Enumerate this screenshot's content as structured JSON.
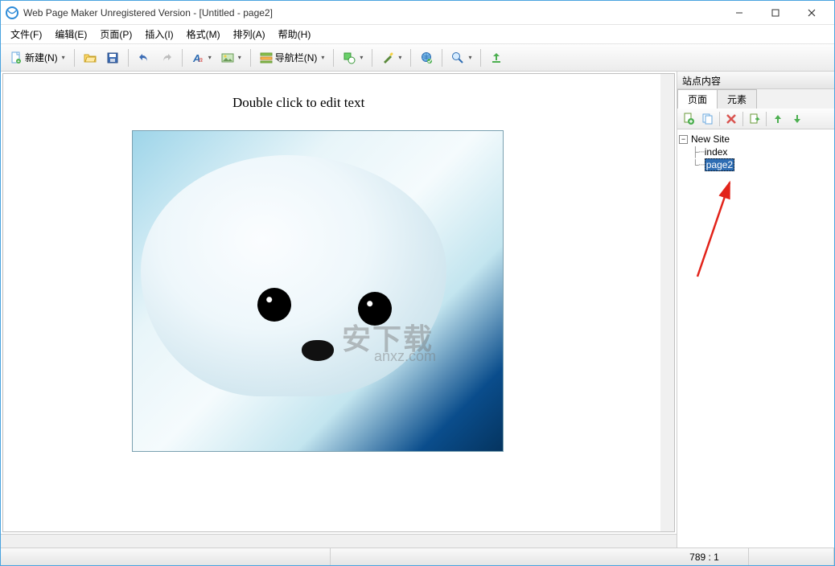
{
  "title": "Web Page Maker Unregistered Version - [Untitled - page2]",
  "menus": {
    "file": "文件(F)",
    "edit": "编辑(E)",
    "page": "页面(P)",
    "insert": "插入(I)",
    "format": "格式(M)",
    "arrange": "排列(A)",
    "help": "帮助(H)"
  },
  "toolbar": {
    "new_label": "新建(N)",
    "navbar_label": "导航栏(N)"
  },
  "canvas": {
    "edit_text": "Double click to edit text",
    "watermark": "安下载",
    "watermark_sub": "anxz.com"
  },
  "side_panel": {
    "title": "站点内容",
    "tabs": {
      "pages": "页面",
      "elements": "元素"
    },
    "tree": {
      "root": "New Site",
      "items": [
        "index",
        "page2"
      ],
      "selected_index": 1
    }
  },
  "status": {
    "coords": "789 : 1"
  }
}
